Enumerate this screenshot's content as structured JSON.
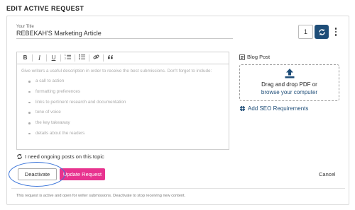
{
  "page": {
    "heading": "EDIT ACTIVE REQUEST"
  },
  "title_field": {
    "label": "Your Title",
    "value": "REBEKAH'S Marketing Article"
  },
  "quantity": {
    "value": "1"
  },
  "editor": {
    "toolbar": [
      "B",
      "I",
      "U",
      "ordered-list",
      "bulleted-list",
      "link",
      "quote"
    ],
    "intro": "Give writers a useful description in order to receive the best submissions. Don't forget to include:",
    "items": [
      "a call to action",
      "formatting preferences",
      "links to pertinent research and documentation",
      "tone of voice",
      "the key takeaway",
      "details about the readers"
    ]
  },
  "ongoing": {
    "label": "I need ongoing posts on this topic"
  },
  "actions": {
    "deactivate": "Deactivate",
    "update": "Update Request",
    "cancel": "Cancel"
  },
  "status_note": "This request is active and open for writer submissions. Deactivate to stop receiving new content.",
  "sidebar": {
    "type_label": "Blog Post",
    "upload_text": "Drag and drop PDF or",
    "upload_link": "browse your computer",
    "seo_link": "Add SEO Requirements"
  },
  "colors": {
    "primary": "#1e4d78",
    "accent_pink": "#e8338f",
    "highlight_blue": "#3a74d9"
  }
}
